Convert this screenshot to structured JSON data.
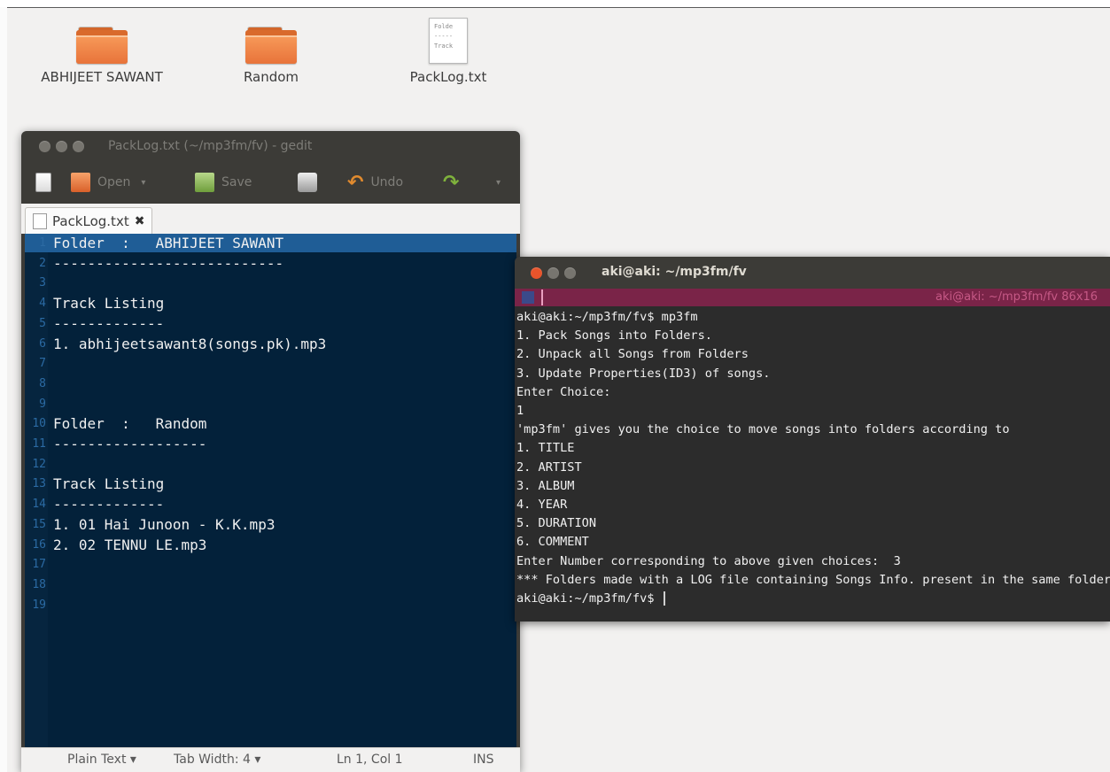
{
  "desktop": {
    "icons": [
      {
        "label": "ABHIJEET SAWANT",
        "kind": "folder"
      },
      {
        "label": "Random",
        "kind": "folder"
      },
      {
        "label": "PackLog.txt",
        "kind": "text-file",
        "preview": [
          "Folde",
          "-----",
          "Track"
        ]
      }
    ]
  },
  "gedit": {
    "title": "PackLog.txt (~/mp3fm/fv) - gedit",
    "toolbar": {
      "open_label": "Open",
      "save_label": "Save",
      "undo_label": "Undo"
    },
    "tab_label": "PackLog.txt",
    "lines": [
      "Folder  :   ABHIJEET SAWANT",
      "---------------------------",
      "",
      "Track Listing",
      "-------------",
      "1. abhijeetsawant8(songs.pk).mp3",
      "",
      "",
      "",
      "Folder  :   Random",
      "------------------",
      "",
      "Track Listing",
      "-------------",
      "1. 01 Hai Junoon - K.K.mp3",
      "2. 02 TENNU LE.mp3",
      "",
      "",
      ""
    ],
    "status": {
      "language": "Plain Text",
      "tab_width": "Tab Width: 4",
      "position": "Ln 1, Col 1",
      "mode": "INS"
    }
  },
  "terminal": {
    "title": "aki@aki: ~/mp3fm/fv",
    "tab_label": "aki@aki: ~/mp3fm/fv 86x16",
    "lines": [
      "aki@aki:~/mp3fm/fv$ mp3fm",
      "1. Pack Songs into Folders.",
      "2. Unpack all Songs from Folders",
      "3. Update Properties(ID3) of songs.",
      "Enter Choice:",
      "1",
      "'mp3fm' gives you the choice to move songs into folders according to",
      "1. TITLE",
      "2. ARTIST",
      "3. ALBUM",
      "4. YEAR",
      "5. DURATION",
      "6. COMMENT",
      "Enter Number corresponding to above given choices:  3",
      "*** Folders made with a LOG file containing Songs Info. present in the same folder",
      "aki@aki:~/mp3fm/fv$ "
    ]
  },
  "colors": {
    "ubuntu_orange": "#dd4814",
    "editor_bg": "#03213a",
    "terminal_bg": "#2c2c2c",
    "terminal_tab": "#7a2448"
  }
}
